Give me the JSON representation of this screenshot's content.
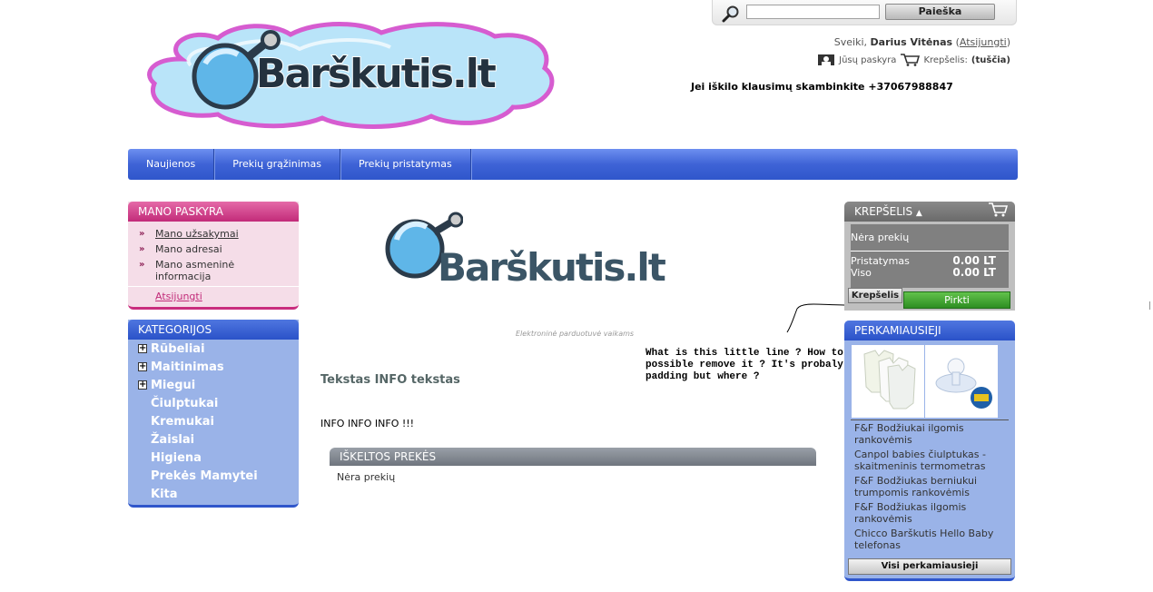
{
  "search": {
    "button_label": "Paieška",
    "value": ""
  },
  "header": {
    "greeting": "Sveiki,",
    "user_name": "Darius Vitėnas",
    "logout_link": "Atsijungti",
    "account_link": "Jūsų paskyra",
    "cart_label": "Krepšelis:",
    "cart_status": "(tuščia)",
    "phone_notice": "Jei iškilo klausimų skambinkite +37067988847",
    "logo_text": "Barškutis.lt"
  },
  "nav": [
    "Naujienos",
    "Prekių grąžinimas",
    "Prekių pristatymas"
  ],
  "account_panel": {
    "title": "MANO PASKYRA",
    "items": [
      "Mano užsakymai",
      "Mano adresai",
      "Mano asmeninė informacija"
    ],
    "logout": "Atsijungti"
  },
  "categories": {
    "title": "KATEGORIJOS",
    "items": [
      "Rūbeliai",
      "Maitinimas",
      "Miegui",
      "Čiulptukai",
      "Kremukai",
      "Žaislai",
      "Higiena",
      "Prekės Mamytei",
      "Kita"
    ]
  },
  "main": {
    "logo_text": "Barškutis.lt",
    "slogan": "Elektroninė parduotuvė vaikams",
    "info_title": "Tekstas INFO tekstas",
    "info_text": "INFO INFO INFO !!!",
    "featured_title": "IŠKELTOS PREKĖS",
    "featured_empty": "Nėra prekių"
  },
  "annotation": "What is this little line ? How to possible remove it ? It's probaly padding but where ?",
  "cart": {
    "title": "KREPŠELIS",
    "empty": "Nėra prekių",
    "shipping_label": "Pristatymas",
    "shipping_value": "0.00 LT",
    "total_label": "Viso",
    "total_value": "0.00 LT",
    "cart_button": "Krepšelis",
    "buy_button": "Pirkti"
  },
  "bestsellers": {
    "title": "PERKAMIAUSIEJI",
    "items": [
      "F&F Bodžiukai ilgomis rankovėmis",
      "Canpol babies čiulptukas - skaitmeninis termometras",
      "F&F Bodžiukas berniukui trumpomis rankovėmis",
      "F&F Bodžiukas ilgomis rankovėmis",
      "Chicco Barškutis Hello Baby telefonas"
    ],
    "all_button": "Visi perkamiausieji"
  },
  "colors": {
    "nav_blue": "#3e63d6",
    "pink": "#c22b79",
    "buy_green": "#2d8e22"
  }
}
